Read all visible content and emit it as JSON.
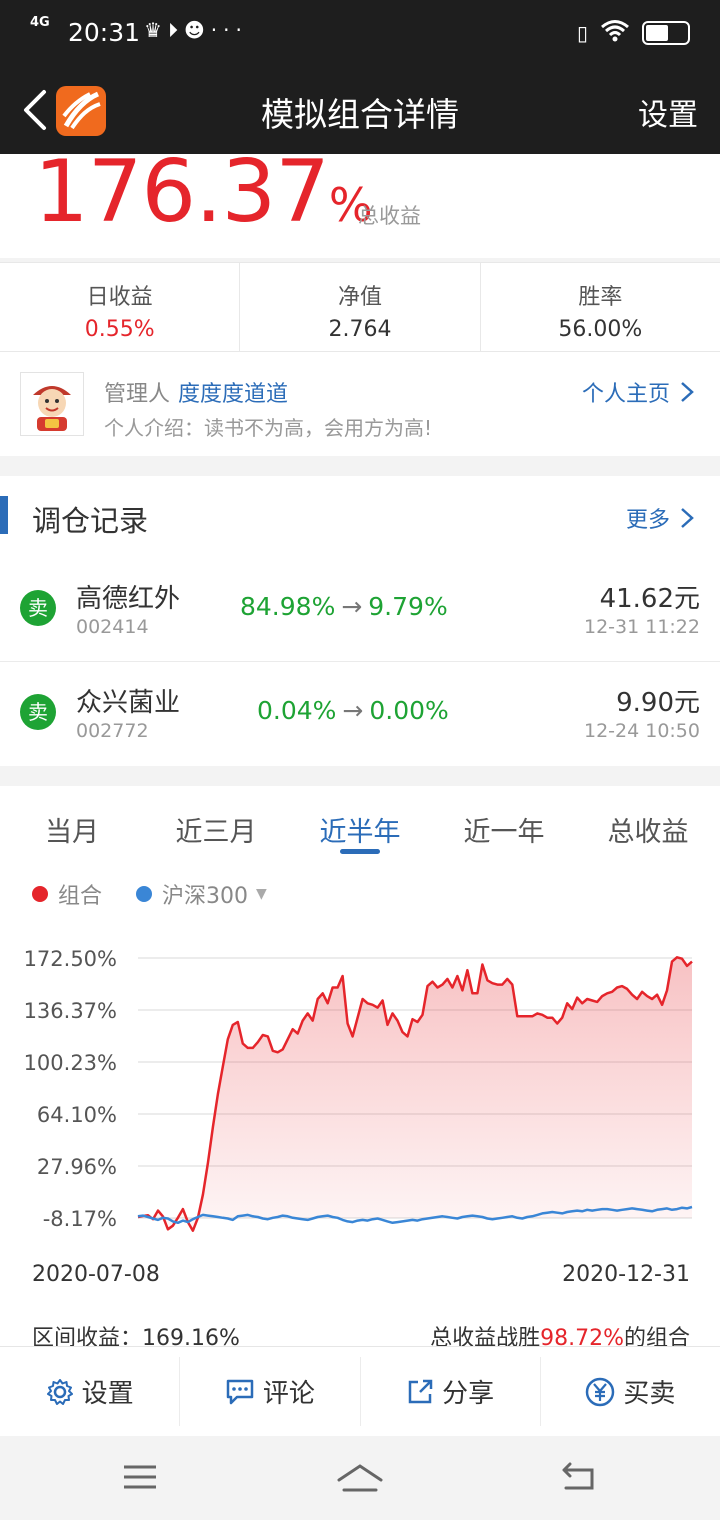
{
  "statusbar": {
    "network": "4G",
    "time": "20:31",
    "icons": [
      "crown-icon",
      "play-icon",
      "cat-icon",
      "more-dots-icon"
    ],
    "right_icons": [
      "vibrate-icon",
      "wifi-icon",
      "battery-icon"
    ],
    "dots": "···"
  },
  "navbar": {
    "title": "模拟组合详情",
    "settings": "设置"
  },
  "returns": {
    "value": "176.37",
    "unit": "%",
    "label": "总收益"
  },
  "stats": [
    {
      "label": "日收益",
      "value": "0.55%"
    },
    {
      "label": "净值",
      "value": "2.764"
    },
    {
      "label": "胜率",
      "value": "56.00%"
    }
  ],
  "manager": {
    "role": "管理人",
    "name": "度度度道道",
    "intro": "个人介绍：读书不为高，会用方为高!",
    "home_link": "个人主页"
  },
  "records": {
    "title": "调仓记录",
    "more": "更多",
    "items": [
      {
        "action": "卖",
        "name": "高德红外",
        "code": "002414",
        "from": "84.98%",
        "arrow": "→",
        "to": "9.79%",
        "price": "41.62元",
        "time": "12-31  11:22"
      },
      {
        "action": "卖",
        "name": "众兴菌业",
        "code": "002772",
        "from": "0.04%",
        "arrow": "→",
        "to": "0.00%",
        "price": "9.90元",
        "time": "12-24  10:50"
      }
    ]
  },
  "chart_tabs": [
    "当月",
    "近三月",
    "近半年",
    "近一年",
    "总收益"
  ],
  "chart_tab_active": 2,
  "legend": {
    "portfolio": "组合",
    "benchmark": "沪深300"
  },
  "colors": {
    "portfolio": "#e5252b",
    "benchmark": "#3a86d6",
    "accent": "#2b6cb8",
    "sell": "#1ea334"
  },
  "chart_data": {
    "type": "area",
    "x_start_label": "2020-07-08",
    "x_end_label": "2020-12-31",
    "y_ticks": [
      "172.50%",
      "136.37%",
      "100.23%",
      "64.10%",
      "27.96%",
      "-8.17%"
    ],
    "ylim": [
      -8.17,
      172.5
    ],
    "grid": true,
    "legend_position": "top-left",
    "series": [
      {
        "name": "组合",
        "values": [
          -7.5,
          -6.8,
          -6.2,
          -9.0,
          -3.0,
          -7.2,
          -16.0,
          -13.5,
          -8.0,
          -2.0,
          -11.0,
          -17.0,
          -8.0,
          8.0,
          30.0,
          55.0,
          78.0,
          97.0,
          116.0,
          126.0,
          128.0,
          113.0,
          110.0,
          110.0,
          114.0,
          119.0,
          118.0,
          108.0,
          107.0,
          109.0,
          116.0,
          123.0,
          120.0,
          129.0,
          134.0,
          129.0,
          144.0,
          148.0,
          141.0,
          152.0,
          152.0,
          160.0,
          127.0,
          118.0,
          131.0,
          144.0,
          141.0,
          140.0,
          138.0,
          143.0,
          126.0,
          134.0,
          129.0,
          121.0,
          118.0,
          130.0,
          128.0,
          133.0,
          153.0,
          156.0,
          152.0,
          154.0,
          158.0,
          152.0,
          160.0,
          150.0,
          164.0,
          148.0,
          148.0,
          168.0,
          157.0,
          155.0,
          154.0,
          154.0,
          158.0,
          154.0,
          132.0,
          132.0,
          132.0,
          132.0,
          134.0,
          133.0,
          131.0,
          131.0,
          127.0,
          131.0,
          141.0,
          137.0,
          145.0,
          141.0,
          144.0,
          143.0,
          142.0,
          146.0,
          148.0,
          149.0,
          152.0,
          153.0,
          151.0,
          147.0,
          144.0,
          149.0,
          146.0,
          144.0,
          147.0,
          140.0,
          150.0,
          170.0,
          173.0,
          172.0,
          167.0,
          170.0
        ],
        "color": "#e5252b"
      },
      {
        "name": "沪深300",
        "values": [
          -7.0,
          -6.5,
          -7.5,
          -8.5,
          -9.5,
          -8.0,
          -8.5,
          -10.5,
          -11.5,
          -10.0,
          -11.0,
          -9.0,
          -7.5,
          -6.0,
          -6.5,
          -7.0,
          -7.5,
          -8.0,
          -8.5,
          -9.5,
          -7.0,
          -6.5,
          -6.0,
          -7.0,
          -7.5,
          -8.5,
          -9.0,
          -8.0,
          -7.5,
          -6.5,
          -7.0,
          -8.0,
          -8.5,
          -9.0,
          -9.5,
          -8.5,
          -7.5,
          -7.0,
          -6.5,
          -7.5,
          -8.0,
          -9.5,
          -10.5,
          -11.0,
          -10.0,
          -9.5,
          -10.0,
          -9.0,
          -8.5,
          -9.5,
          -10.5,
          -11.5,
          -11.0,
          -10.5,
          -10.0,
          -9.5,
          -10.0,
          -9.0,
          -8.5,
          -8.0,
          -7.5,
          -7.0,
          -7.5,
          -8.0,
          -8.5,
          -7.5,
          -7.0,
          -6.5,
          -7.0,
          -7.5,
          -8.5,
          -9.0,
          -8.5,
          -8.0,
          -7.5,
          -7.0,
          -8.0,
          -8.5,
          -7.5,
          -7.0,
          -6.0,
          -5.0,
          -4.5,
          -4.0,
          -4.5,
          -5.0,
          -4.0,
          -3.5,
          -3.0,
          -3.5,
          -2.5,
          -3.0,
          -2.5,
          -2.0,
          -2.0,
          -2.5,
          -3.0,
          -2.5,
          -2.0,
          -1.5,
          -2.0,
          -2.5,
          -3.0,
          -3.5,
          -2.5,
          -2.0,
          -1.5,
          -2.5,
          -2.0,
          -1.0,
          -1.5,
          -0.5
        ],
        "color": "#3a86d6"
      }
    ]
  },
  "summary": {
    "interval_label": "区间收益：169.16%",
    "beat_prefix": "总收益战胜",
    "beat_value": "98.72%",
    "beat_suffix": "的组合"
  },
  "actions": [
    {
      "label": "设置",
      "icon": "gear-icon"
    },
    {
      "label": "评论",
      "icon": "comment-icon"
    },
    {
      "label": "分享",
      "icon": "share-icon"
    },
    {
      "label": "买卖",
      "icon": "yuan-icon"
    }
  ],
  "sysnav": [
    "menu-icon",
    "home-icon",
    "back-icon"
  ]
}
